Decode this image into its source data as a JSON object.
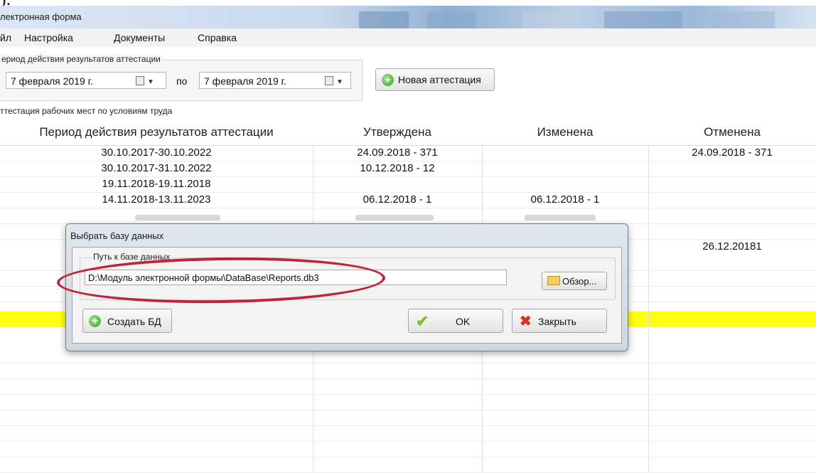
{
  "caption_text": ").",
  "window": {
    "title": "лектронная форма"
  },
  "menu": [
    "йл",
    "Настройка",
    "Документы",
    "Справка"
  ],
  "filter": {
    "group_label": "ериод действия результатов аттестации",
    "date_from": "7 февраля 2019 г.",
    "po_label": "по",
    "date_to": "7 февраля 2019 г.",
    "new_button": "Новая аттестация"
  },
  "section_label": "ттестация рабочих мест по условиям труда",
  "table": {
    "headers": [
      "Период действия результатов аттестации",
      "Утверждена",
      "Изменена",
      "Отменена"
    ],
    "rows": [
      [
        "30.10.2017-30.10.2022",
        "24.09.2018 - 371",
        "",
        "24.09.2018 - 371"
      ],
      [
        "30.10.2017-31.10.2022",
        "10.12.2018 - 12",
        "",
        ""
      ],
      [
        "19.11.2018-19.11.2018",
        "",
        "",
        ""
      ],
      [
        "14.11.2018-13.11.2023",
        "06.12.2018 - 1",
        "06.12.2018 - 1",
        ""
      ],
      [
        "",
        "",
        "",
        ""
      ],
      [
        "",
        "",
        "",
        "26.12.20181"
      ]
    ]
  },
  "dialog": {
    "title": "Выбрать базу данных",
    "path_label": "Путь к базе данных",
    "path_value": "D:\\Модуль электронной формы\\DataBase\\Reports.db3",
    "browse_button": "Обзор...",
    "create_button": "Создать БД",
    "ok_button": "OK",
    "close_button": "Закрыть"
  },
  "colors": {
    "highlight_row": "#ffff12",
    "annotation_ellipse": "#c0243a"
  }
}
